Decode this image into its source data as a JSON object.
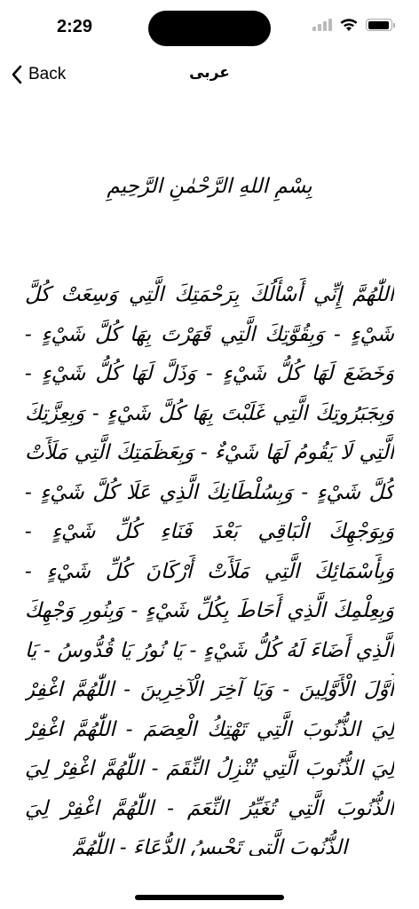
{
  "status_bar": {
    "time": "2:29"
  },
  "nav": {
    "back_label": "Back",
    "title": "عربی"
  },
  "content": {
    "basmala": "بِسْمِ اللهِ الرَّحْمٰنِ الرَّحِيمِ",
    "dua": "اللّٰهُمَّ إِنِّي أَسْأَلُكَ بِرَحْمَتِكَ الَّتِي وَسِعَتْ كُلَّ شَيْءٍ - وَبِقُوَّتِكَ الَّتِي قَهَرْتَ بِهَا كُلَّ شَيْءٍ - وَخَضَعَ لَهَا كُلُّ شَيْءٍ - وَذَلَّ لَهَا كُلُّ شَيْءٍ - وَبِجَبَرُوتِكَ الَّتِي غَلَبْتَ بِهَا كُلَّ شَيْءٍ - وَبِعِزَّتِكَ الَّتِي لَا يَقُومُ لَهَا شَيْءٌ - وَبِعَظَمَتِكَ الَّتِي مَلَأَتْ كُلَّ شَيْءٍ - وَبِسُلْطَانِكَ الَّذِي عَلَا كُلَّ شَيْءٍ - وَبِوَجْهِكَ الْبَاقِي بَعْدَ فَنَاءِ كُلِّ شَيْءٍ - وَبِأَسْمَائِكَ الَّتِي مَلَأَتْ أَرْكَانَ كُلِّ شَيْءٍ - وَبِعِلْمِكَ الَّذِي أَحَاطَ بِكُلِّ شَيْءٍ - وَبِنُورِ وَجْهِكَ الَّذِي أَضَاءَ لَهُ كُلُّ شَيْءٍ - يَا نُورُ يَا قُدُّوسُ - يَا أَوَّلَ الْأَوَّلِينَ - وَيَا آخِرَ الْآخِرِينَ - اللّٰهُمَّ اغْفِرْ لِيَ الذُّنُوبَ الَّتِي تَهْتِكُ الْعِصَمَ - اللّٰهُمَّ اغْفِرْ لِيَ الذُّنُوبَ الَّتِي تُنْزِلُ النِّقَمَ - اللّٰهُمَّ اغْفِرْ لِيَ الذُّنُوبَ الَّتِي تُغَيِّرُ النِّعَمَ - اللّٰهُمَّ اغْفِرْ لِيَ الذُّنُوبَ الَّتِي تَحْبِسُ الدُّعَاءَ - اللّٰهُمَّ"
  }
}
